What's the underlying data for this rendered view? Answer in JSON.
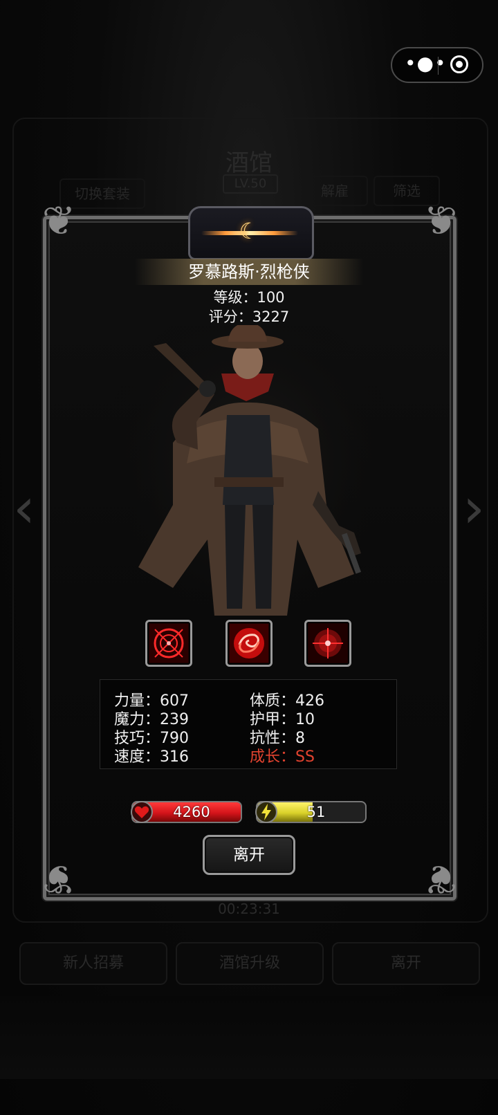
{
  "background": {
    "title": "酒馆",
    "level": "LV.50",
    "tabs": [
      "切换套装",
      "解雇",
      "筛选"
    ],
    "timer": "00:23:31",
    "buttons": [
      "新人招募",
      "酒馆升级",
      "离开"
    ]
  },
  "hero": {
    "name": "罗慕路斯·烈枪侠",
    "level_label": "等级：100",
    "score_label": "评分：3227"
  },
  "skills": [
    {
      "icon": "crosshair-ring-icon"
    },
    {
      "icon": "swirl-icon"
    },
    {
      "icon": "target-icon"
    }
  ],
  "stats": {
    "left": [
      "力量：607",
      "魔力：239",
      "技巧：790",
      "速度：316"
    ],
    "right": [
      "体质：426",
      "护甲：10",
      "抗性：8",
      "成长：SS"
    ]
  },
  "hp": {
    "value": "4260",
    "fraction": 1.0,
    "color": "#d4141a",
    "icon": "heart-icon"
  },
  "energy": {
    "value": "51",
    "fraction": 0.51,
    "color": "#d9d12a",
    "icon": "lightning-icon"
  },
  "leave_label": "离开",
  "colors": {
    "growth": "#e2432f",
    "accent": "#ff9b3d"
  }
}
